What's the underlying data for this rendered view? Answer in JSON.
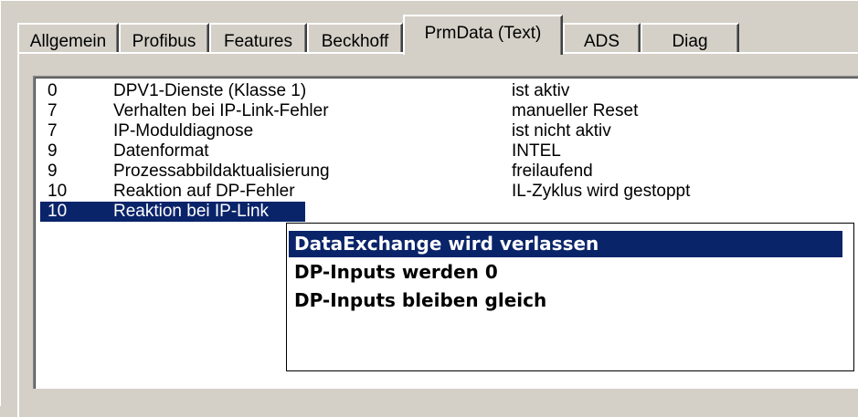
{
  "tabs": [
    {
      "label": "Allgemein"
    },
    {
      "label": "Profibus"
    },
    {
      "label": "Features"
    },
    {
      "label": "Beckhoff"
    },
    {
      "label": "PrmData (Text)",
      "selected": true
    },
    {
      "label": "ADS"
    },
    {
      "label": "Diag"
    }
  ],
  "params": [
    {
      "num": "0",
      "name": "DPV1-Dienste (Klasse 1)",
      "value": "ist aktiv"
    },
    {
      "num": "7",
      "name": "Verhalten bei IP-Link-Fehler",
      "value": "manueller Reset"
    },
    {
      "num": "7",
      "name": "IP-Moduldiagnose",
      "value": "ist nicht aktiv"
    },
    {
      "num": "9",
      "name": "Datenformat",
      "value": "INTEL"
    },
    {
      "num": "9",
      "name": "Prozessabbildaktualisierung",
      "value": "freilaufend"
    },
    {
      "num": "10",
      "name": "Reaktion auf DP-Fehler",
      "value": "IL-Zyklus wird gestoppt"
    },
    {
      "num": "10",
      "name": "Reaktion bei IP-Link",
      "value": "",
      "selected": true
    }
  ],
  "dropdown": {
    "options": [
      {
        "label": "DataExchange wird verlassen",
        "highlighted": true
      },
      {
        "label": "DP-Inputs werden 0"
      },
      {
        "label": "DP-Inputs bleiben gleich"
      }
    ]
  },
  "colors": {
    "selection": "#0a246a",
    "face": "#d4d0c8"
  }
}
